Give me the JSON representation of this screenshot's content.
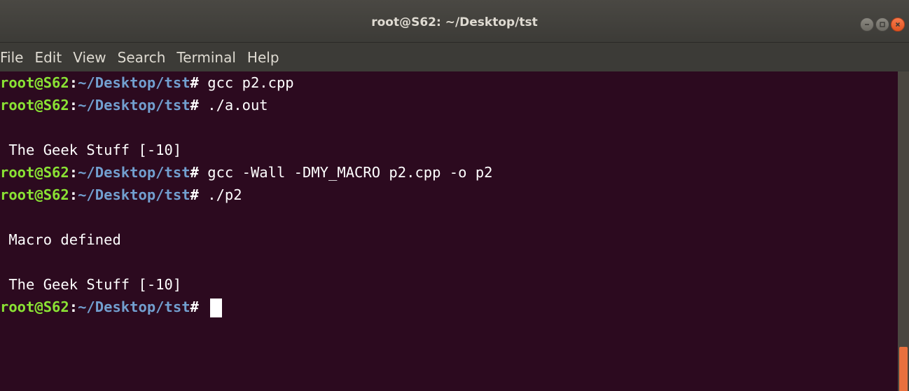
{
  "window": {
    "title": "root@S62: ~/Desktop/tst"
  },
  "controls": {
    "minimize_icon": "minimize-icon",
    "maximize_icon": "maximize-icon",
    "close_icon": "close-icon",
    "close_color": "#e95420"
  },
  "menu": [
    "File",
    "Edit",
    "View",
    "Search",
    "Terminal",
    "Help"
  ],
  "prompt": {
    "user_host": "root@S62",
    "separator": ":",
    "path": "~/Desktop/tst",
    "symbol": "#"
  },
  "lines": [
    {
      "type": "cmd",
      "text": " gcc p2.cpp"
    },
    {
      "type": "cmd",
      "text": " ./a.out"
    },
    {
      "type": "out",
      "text": ""
    },
    {
      "type": "out",
      "text": " The Geek Stuff [-10]"
    },
    {
      "type": "cmd",
      "text": " gcc -Wall -DMY_MACRO p2.cpp -o p2"
    },
    {
      "type": "cmd",
      "text": " ./p2"
    },
    {
      "type": "out",
      "text": ""
    },
    {
      "type": "out",
      "text": " Macro defined"
    },
    {
      "type": "out",
      "text": ""
    },
    {
      "type": "out",
      "text": " The Geek Stuff [-10]"
    },
    {
      "type": "cmd",
      "text": " ",
      "cursor": true
    }
  ],
  "colors": {
    "background": "#2c0a1f",
    "prompt_user": "#8ae234",
    "prompt_path": "#729fcf",
    "scrollbar_thumb": "#e9703e"
  }
}
